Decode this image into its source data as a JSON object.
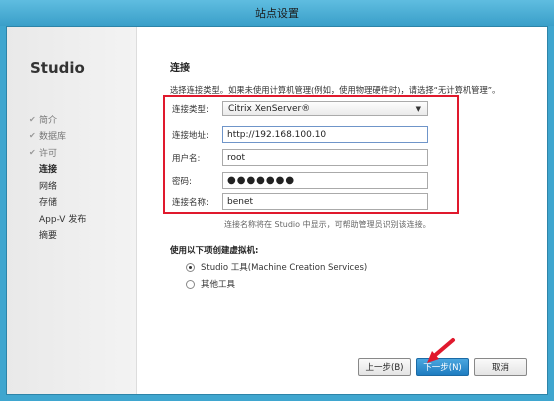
{
  "window": {
    "title": "站点设置"
  },
  "sidebar": {
    "brand": "Studio",
    "items": [
      {
        "label": "简介",
        "done": true
      },
      {
        "label": "数据库",
        "done": true
      },
      {
        "label": "许可",
        "done": true
      },
      {
        "label": "连接",
        "current": true
      },
      {
        "label": "网络"
      },
      {
        "label": "存储"
      },
      {
        "label": "App-V 发布"
      },
      {
        "label": "摘要"
      }
    ]
  },
  "main": {
    "section_title": "连接",
    "instruction": "选择连接类型。如果未使用计算机管理(例如，使用物理硬件时)，请选择“无计算机管理”。",
    "form": {
      "type_label": "连接类型:",
      "type_value": "Citrix XenServer®",
      "address_label": "连接地址:",
      "address_value": "http://192.168.100.10",
      "user_label": "用户名:",
      "user_value": "root",
      "password_label": "密码:",
      "password_value": "●●●●●●●",
      "name_label": "连接名称:",
      "name_value": "benet"
    },
    "hint": "连接名称将在 Studio 中显示，可帮助管理员识别该连接。",
    "vm_title": "使用以下项创建虚拟机:",
    "vm_options": [
      {
        "label": "Studio 工具(Machine Creation Services)",
        "selected": true
      },
      {
        "label": "其他工具",
        "selected": false
      }
    ]
  },
  "footer": {
    "back_label": "上一步(B)",
    "next_label": "下一步(N)",
    "cancel_label": "取消"
  },
  "colors": {
    "highlight_box": "#e0192d",
    "primary_button": "#1e7cc0"
  }
}
